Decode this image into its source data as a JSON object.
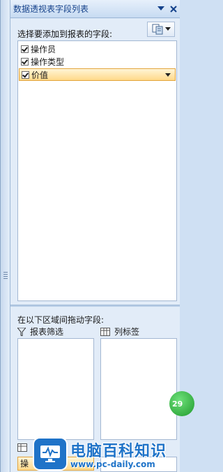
{
  "window": {
    "title": "数据透视表字段列表"
  },
  "field_section": {
    "label": "选择要添加到报表的字段:",
    "fields": [
      {
        "label": "操作员",
        "checked": true,
        "selected": false
      },
      {
        "label": "操作类型",
        "checked": true,
        "selected": false
      },
      {
        "label": "价值",
        "checked": true,
        "selected": true
      }
    ]
  },
  "areas_section": {
    "label": "在以下区域间拖动字段:",
    "report_filter": {
      "label": "报表筛选",
      "icon": "filter-icon"
    },
    "column_labels": {
      "label": "列标签",
      "icon": "grid-icon"
    },
    "row_labels_partial": {
      "item": "操"
    }
  },
  "overlay": {
    "bubble_text": "29"
  },
  "watermark": {
    "title": "电脑百科知识",
    "url": "www.pc-daily.com"
  },
  "colors": {
    "title_text": "#15428b",
    "selection_fill": "#ffd98a",
    "selection_border": "#e3a43c",
    "panel_bg": "#e2ecf8",
    "watermark_blue": "#1f73c8",
    "bubble_green": "#1f9a2c"
  }
}
